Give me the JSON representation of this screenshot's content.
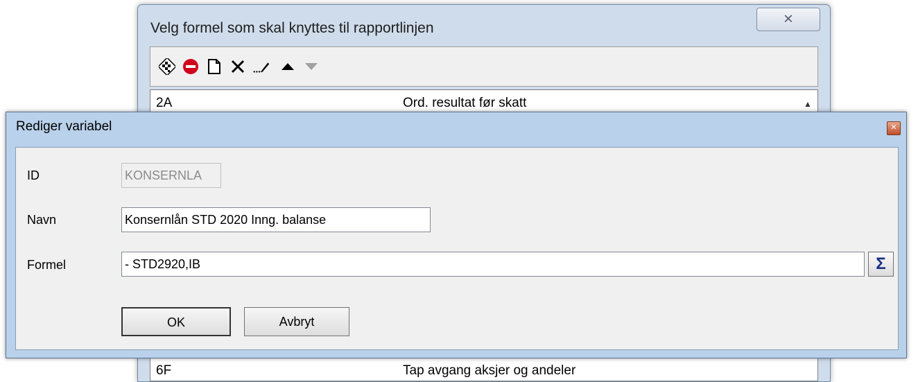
{
  "back_dialog": {
    "title": "Velg formel som skal knyttes til rapportlinjen",
    "close_label": "⨯",
    "toolbar": {
      "icons": [
        "checkered-flag-icon",
        "stop-icon",
        "new-document-icon",
        "delete-icon",
        "edit-pencil-icon",
        "move-up-icon",
        "move-down-icon"
      ]
    },
    "list": [
      {
        "code": "2A",
        "desc": "Ord. resultat før skatt"
      },
      {
        "code": "6F",
        "desc": "Tap avgang aksjer og andeler"
      }
    ]
  },
  "edit_dialog": {
    "title": "Rediger variabel",
    "id_label": "ID",
    "id_value": "KONSERNLA",
    "name_label": "Navn",
    "name_value": "Konsernlån STD 2020 Inng. balanse",
    "formula_label": "Formel",
    "formula_value": "- STD2920,IB",
    "sigma_label": "Σ",
    "ok_label": "OK",
    "cancel_label": "Avbryt"
  },
  "colors": {
    "title_bar": "#b9d1ea",
    "client_bg": "#f0f0f0",
    "close_red": "#c0502c"
  }
}
